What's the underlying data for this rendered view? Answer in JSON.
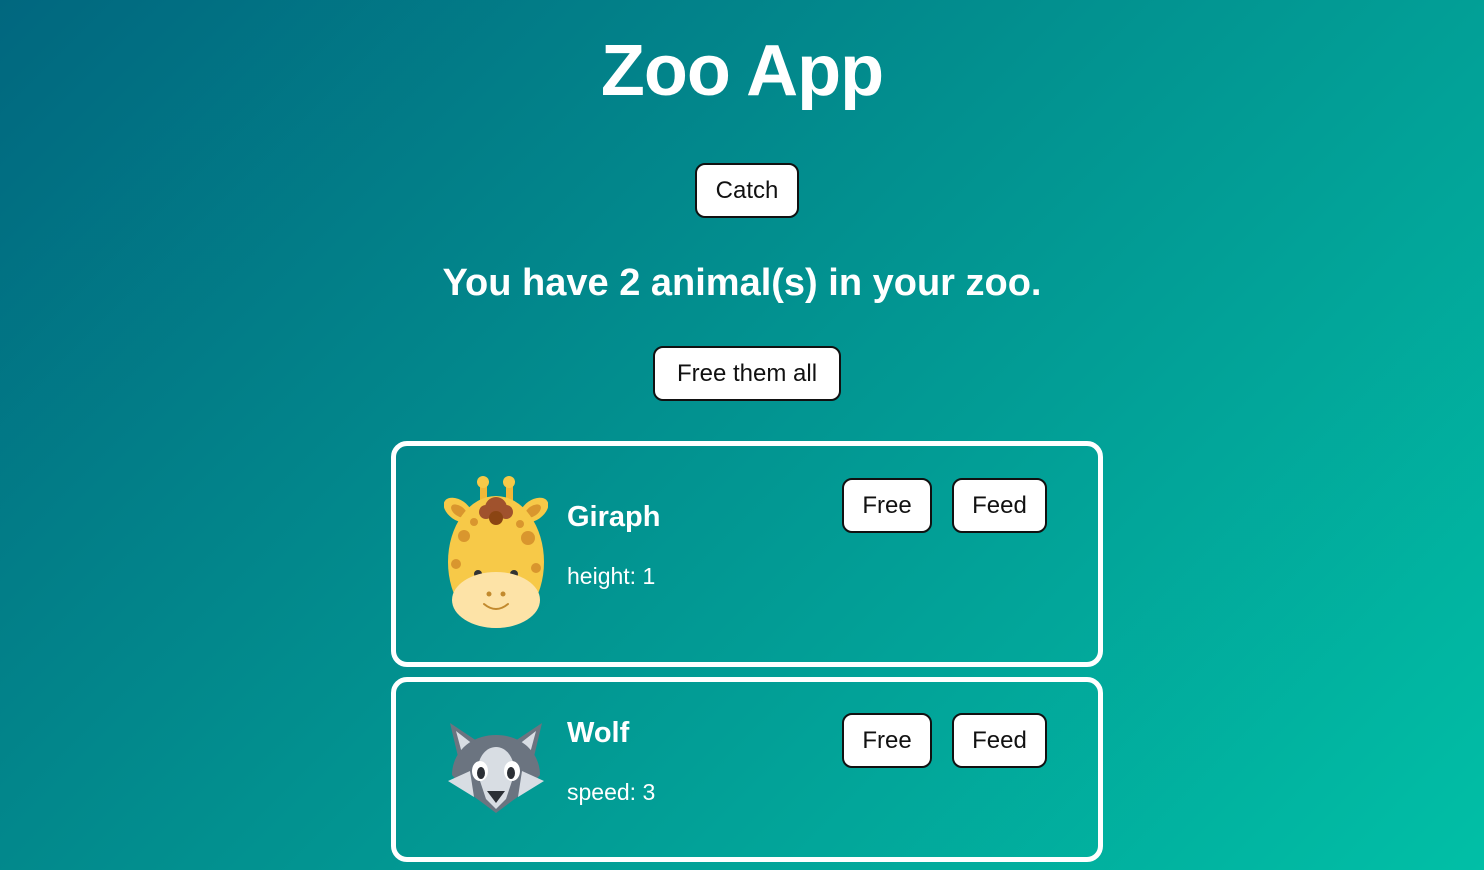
{
  "app": {
    "title": "Zoo App"
  },
  "controls": {
    "catch_label": "Catch",
    "summary": "You have 2 animal(s) in your zoo.",
    "free_all_label": "Free them all"
  },
  "animals": [
    {
      "name": "Giraph",
      "stat": "height: 1",
      "icon": "giraffe-icon",
      "free_label": "Free",
      "feed_label": "Feed"
    },
    {
      "name": "Wolf",
      "stat": "speed: 3",
      "icon": "wolf-icon",
      "free_label": "Free",
      "feed_label": "Feed"
    }
  ],
  "colors": {
    "gradient_start": "#01677f",
    "gradient_mid": "#02908f",
    "gradient_end": "#01bfa6",
    "card_border": "#ffffff",
    "button_bg": "#ffffff",
    "button_border": "#111111"
  }
}
